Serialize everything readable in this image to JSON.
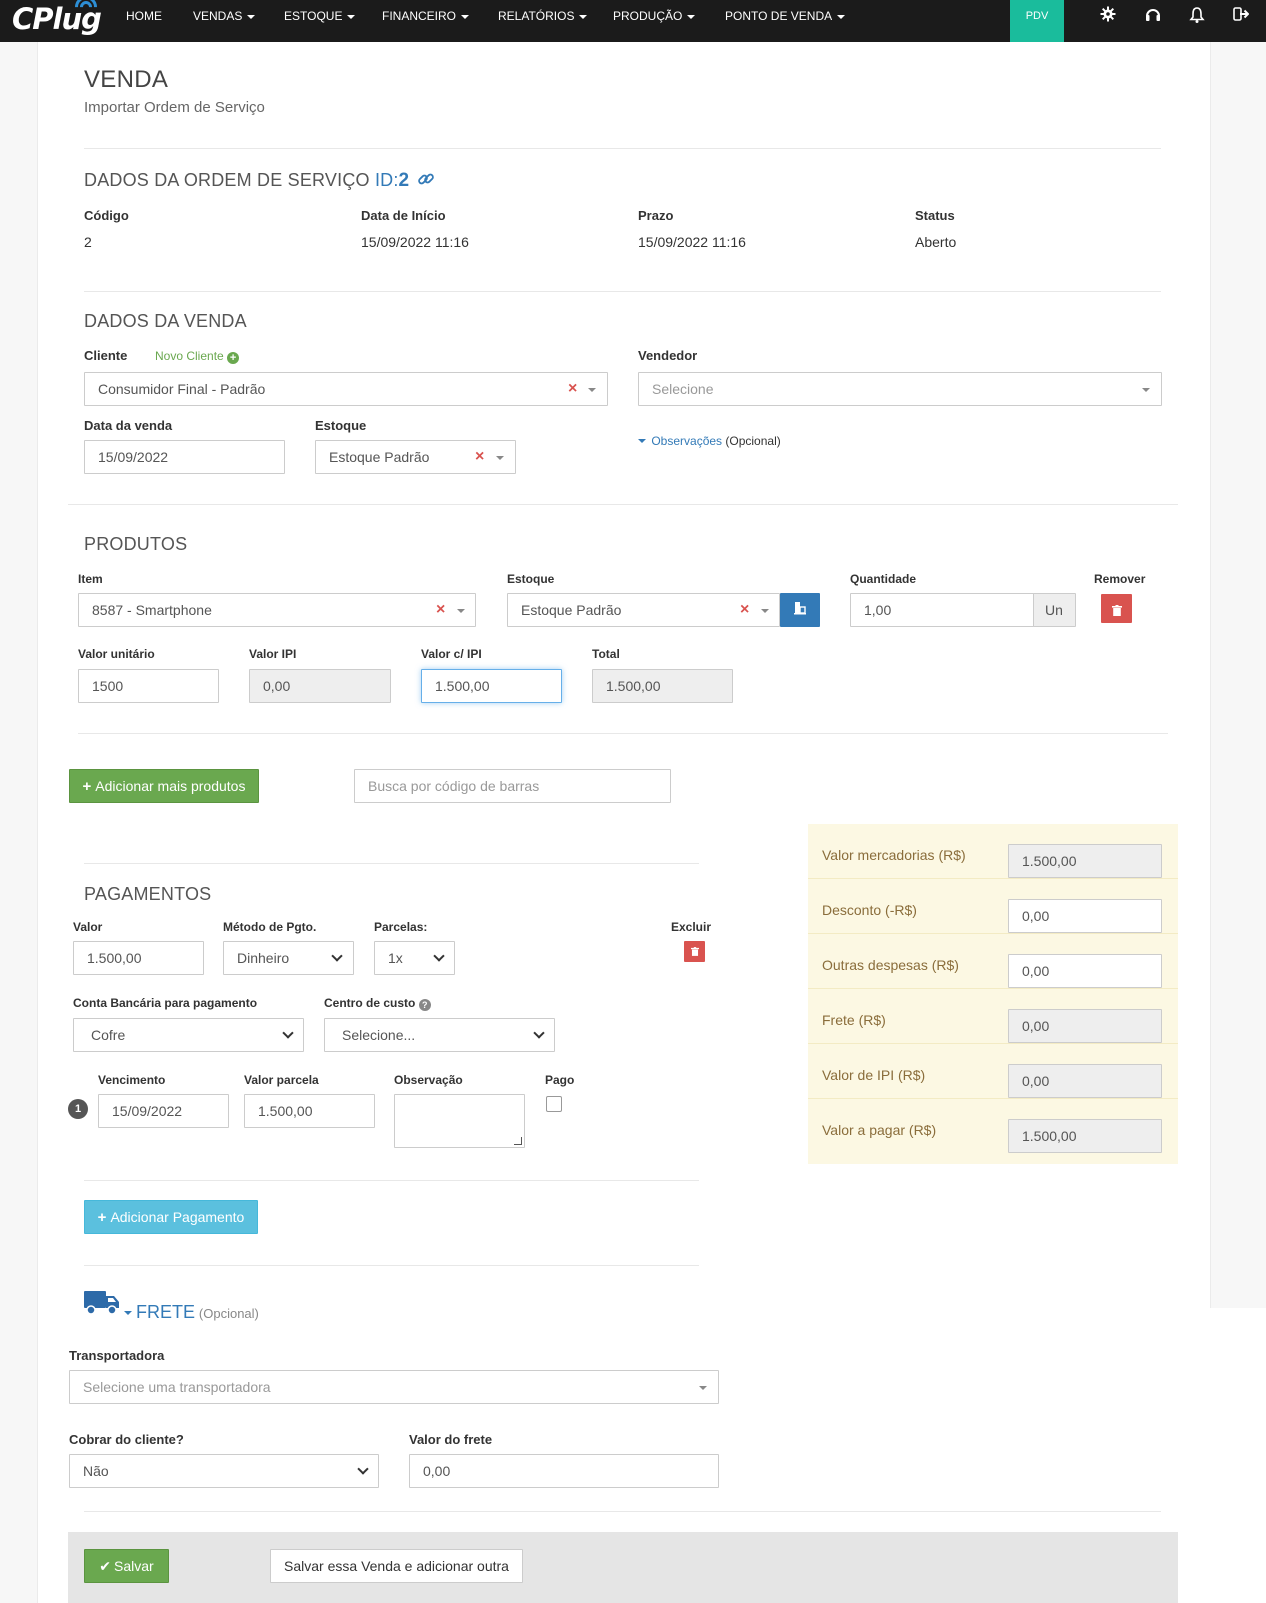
{
  "nav": {
    "logo": "CPlug",
    "items": [
      "HOME",
      "VENDAS",
      "ESTOQUE",
      "FINANCEIRO",
      "RELATÓRIOS",
      "PRODUÇÃO",
      "PONTO DE VENDA"
    ],
    "pdv": "PDV",
    "icons": [
      "gear-icon",
      "headset-icon",
      "bell-icon",
      "logout-icon"
    ]
  },
  "page": {
    "title": "VENDA",
    "subtitle": "Importar Ordem de Serviço"
  },
  "os": {
    "heading": "DADOS DA ORDEM DE SERVIÇO",
    "id_label": "ID:",
    "id_value": "2",
    "fields": [
      {
        "label": "Código",
        "value": "2"
      },
      {
        "label": "Data de Início",
        "value": "15/09/2022 11:16"
      },
      {
        "label": "Prazo",
        "value": "15/09/2022 11:16"
      },
      {
        "label": "Status",
        "value": "Aberto"
      }
    ]
  },
  "venda": {
    "heading": "DADOS DA VENDA",
    "cliente_label": "Cliente",
    "novo_cliente": "Novo Cliente",
    "cliente_value": "Consumidor Final - Padrão",
    "vendedor_label": "Vendedor",
    "vendedor_placeholder": "Selecione",
    "data_label": "Data da venda",
    "data_value": "15/09/2022",
    "estoque_label": "Estoque",
    "estoque_value": "Estoque Padrão",
    "obs_link": "Observações",
    "obs_optional": "(Opcional)"
  },
  "produtos": {
    "heading": "PRODUTOS",
    "item_label": "Item",
    "item_value": "8587 - Smartphone",
    "estoque_label": "Estoque",
    "estoque_value": "Estoque Padrão",
    "qtd_label": "Quantidade",
    "qtd_value": "1,00",
    "unit": "Un",
    "remover_label": "Remover",
    "valor_unit_label": "Valor unitário",
    "valor_unit_value": "1500",
    "ipi_label": "Valor IPI",
    "ipi_value": "0,00",
    "com_ipi_label": "Valor c/ IPI",
    "com_ipi_value": "1.500,00",
    "total_label": "Total",
    "total_value": "1.500,00",
    "add_button": "Adicionar mais produtos",
    "barcode_placeholder": "Busca por código de barras"
  },
  "pagamentos": {
    "heading": "PAGAMENTOS",
    "valor_label": "Valor",
    "valor_value": "1.500,00",
    "metodo_label": "Método de Pgto.",
    "metodo_value": "Dinheiro",
    "parcelas_label": "Parcelas:",
    "parcelas_value": "1x",
    "excluir_label": "Excluir",
    "conta_label": "Conta Bancária para pagamento",
    "conta_value": "Cofre",
    "centro_label": "Centro de custo",
    "centro_value": "Selecione...",
    "parcela_num": "1",
    "venc_label": "Vencimento",
    "venc_value": "15/09/2022",
    "valor_parcela_label": "Valor parcela",
    "valor_parcela_value": "1.500,00",
    "obs_label": "Observação",
    "pago_label": "Pago",
    "add_button": "Adicionar Pagamento"
  },
  "totais": [
    {
      "label": "Valor mercadorias (R$)",
      "value": "1.500,00",
      "disabled": true
    },
    {
      "label": "Desconto (-R$)",
      "value": "0,00",
      "disabled": false
    },
    {
      "label": "Outras despesas (R$)",
      "value": "0,00",
      "disabled": false
    },
    {
      "label": "Frete (R$)",
      "value": "0,00",
      "disabled": true
    },
    {
      "label": "Valor de IPI (R$)",
      "value": "0,00",
      "disabled": true
    },
    {
      "label": "Valor a pagar (R$)",
      "value": "1.500,00",
      "disabled": true
    }
  ],
  "frete": {
    "heading": "FRETE",
    "optional": "(Opcional)",
    "transportadora_label": "Transportadora",
    "transportadora_placeholder": "Selecione uma transportadora",
    "cobrar_label": "Cobrar do cliente?",
    "cobrar_value": "Não",
    "valor_label": "Valor do frete",
    "valor_value": "0,00"
  },
  "footer": {
    "save": "Salvar",
    "save_add": "Salvar essa Venda e adicionar outra"
  },
  "colors": {
    "topbar": "#1b1b1b",
    "pdv": "#1abc9c",
    "success": "#6aa84f",
    "info": "#5bc0de",
    "danger": "#d9534f",
    "link": "#337ab7",
    "totals_bg": "#fcf8e3"
  }
}
